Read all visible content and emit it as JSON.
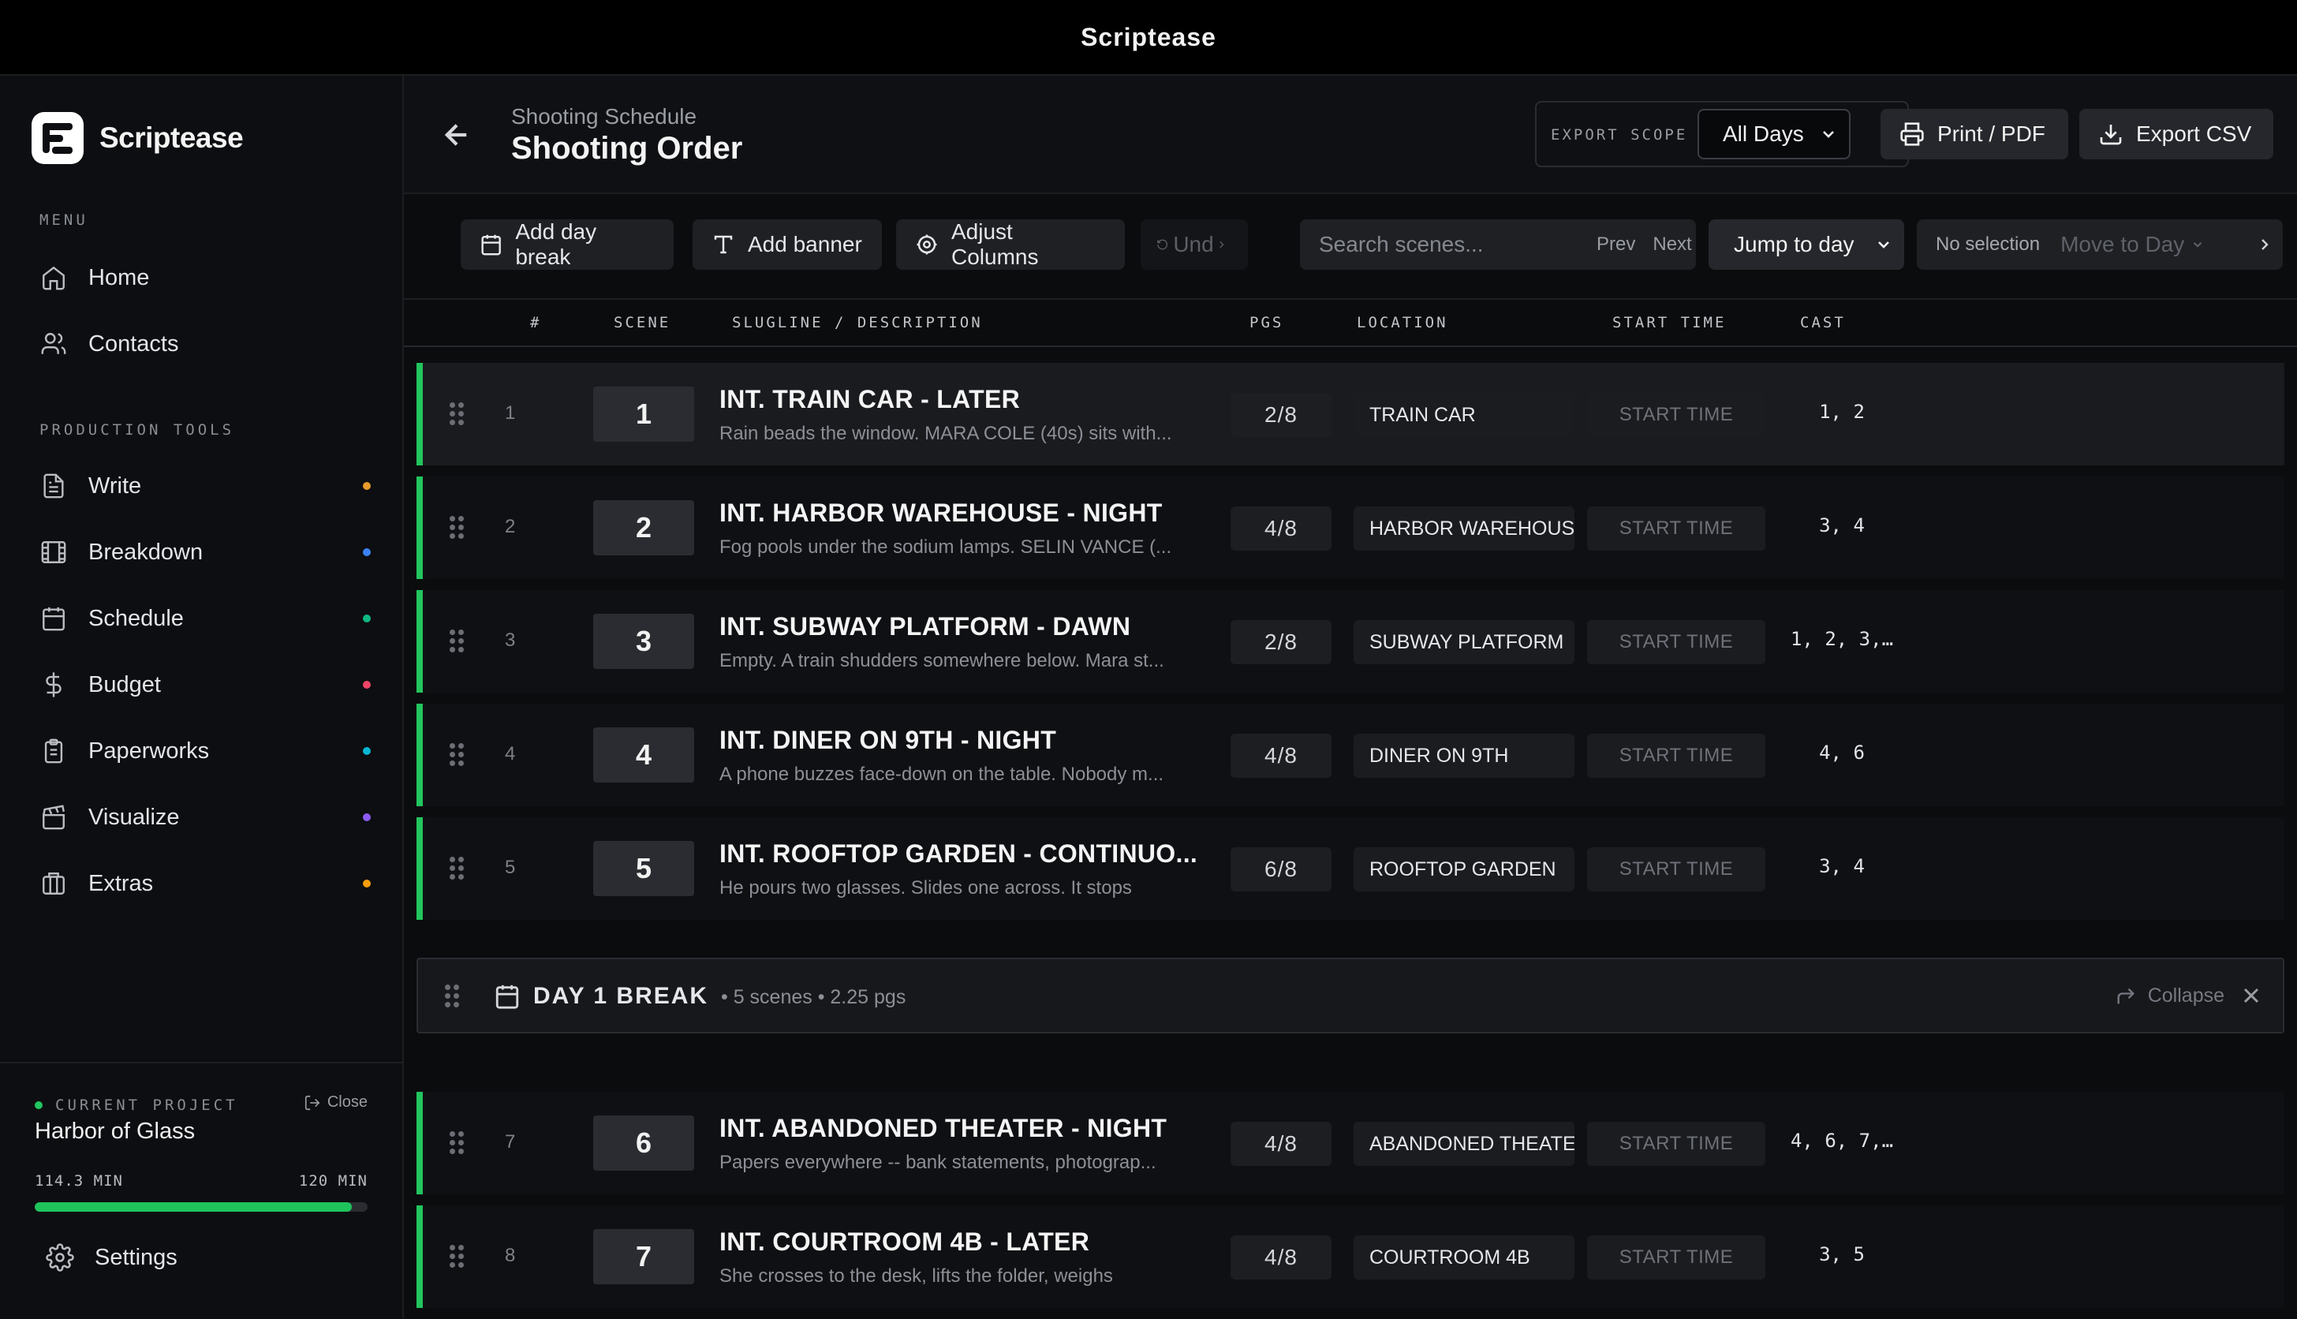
{
  "window": {
    "title": "Scriptease"
  },
  "sidebar": {
    "brand": "Scriptease",
    "menu_heading": "MENU",
    "menu": [
      {
        "label": "Home",
        "icon": "home-icon"
      },
      {
        "label": "Contacts",
        "icon": "users-icon"
      }
    ],
    "tools_heading": "PRODUCTION TOOLS",
    "tools": [
      {
        "label": "Write",
        "icon": "file-text-icon",
        "dot": "#e59a2b"
      },
      {
        "label": "Breakdown",
        "icon": "film-icon",
        "dot": "#3b82f6"
      },
      {
        "label": "Schedule",
        "icon": "calendar-icon",
        "dot": "#10b981"
      },
      {
        "label": "Budget",
        "icon": "dollar-icon",
        "dot": "#ef4466"
      },
      {
        "label": "Paperworks",
        "icon": "clipboard-icon",
        "dot": "#06b6d4"
      },
      {
        "label": "Visualize",
        "icon": "clapperboard-icon",
        "dot": "#8b5cf6"
      },
      {
        "label": "Extras",
        "icon": "package-icon",
        "dot": "#f59e0b"
      }
    ],
    "project": {
      "label": "CURRENT PROJECT",
      "close_label": "Close",
      "name": "Harbor of Glass",
      "used": "114.3 MIN",
      "total": "120 MIN",
      "progress": 0.9525
    },
    "settings_label": "Settings"
  },
  "header": {
    "breadcrumb": "Shooting Schedule",
    "title": "Shooting Order",
    "export_scope_label": "EXPORT SCOPE",
    "export_scope_value": "All Days",
    "print_label": "Print / PDF",
    "export_label": "Export CSV"
  },
  "toolbar": {
    "add_day_break": "Add day break",
    "add_banner": "Add banner",
    "adjust_columns": "Adjust Columns",
    "undo": "Und",
    "search_placeholder": "Search scenes...",
    "prev": "Prev",
    "next": "Next",
    "jump_to_day": "Jump to day",
    "no_selection": "No selection",
    "move_to_day": "Move to Day"
  },
  "table": {
    "columns": [
      "#",
      "SCENE",
      "SLUGLINE / DESCRIPTION",
      "PGS",
      "LOCATION",
      "START TIME",
      "CAST"
    ],
    "start_time_placeholder": "START TIME",
    "rows_before_break": [
      {
        "num": "1",
        "scene": "1",
        "slug": "INT. TRAIN CAR - LATER",
        "desc": "Rain beads the window. MARA COLE (40s) sits with...",
        "pgs": "2/8",
        "location": "TRAIN CAR",
        "cast": "1, 2"
      },
      {
        "num": "2",
        "scene": "2",
        "slug": "INT. HARBOR WAREHOUSE - NIGHT",
        "desc": "Fog pools under the sodium lamps. SELIN VANCE (...",
        "pgs": "4/8",
        "location": "HARBOR WAREHOUSE",
        "cast": "3, 4"
      },
      {
        "num": "3",
        "scene": "3",
        "slug": "INT. SUBWAY PLATFORM - DAWN",
        "desc": "Empty. A train shudders somewhere below. Mara st...",
        "pgs": "2/8",
        "location": "SUBWAY PLATFORM",
        "cast": "1, 2, 3,…"
      },
      {
        "num": "4",
        "scene": "4",
        "slug": "INT. DINER ON 9TH - NIGHT",
        "desc": "A phone buzzes face-down on the table. Nobody m...",
        "pgs": "4/8",
        "location": "DINER ON 9TH",
        "cast": "4, 6"
      },
      {
        "num": "5",
        "scene": "5",
        "slug": "INT. ROOFTOP GARDEN - CONTINUO...",
        "desc": "He pours two glasses. Slides one across. It stops",
        "pgs": "6/8",
        "location": "ROOFTOP GARDEN",
        "cast": "3, 4"
      }
    ],
    "day_break": {
      "title": "DAY 1 BREAK",
      "meta": "• 5 scenes • 2.25 pgs",
      "collapse_label": "Collapse"
    },
    "rows_after_break": [
      {
        "num": "7",
        "scene": "6",
        "slug": "INT. ABANDONED THEATER - NIGHT",
        "desc": "Papers everywhere -- bank statements, photograp...",
        "pgs": "4/8",
        "location": "ABANDONED THEATE",
        "cast": "4, 6, 7,…"
      },
      {
        "num": "8",
        "scene": "7",
        "slug": "INT. COURTROOM 4B - LATER",
        "desc": "She crosses to the desk, lifts the folder, weighs",
        "pgs": "4/8",
        "location": "COURTROOM 4B",
        "cast": "3, 5"
      }
    ]
  },
  "colors": {
    "accent_green": "#22c55e",
    "background": "#0b0c0e"
  }
}
